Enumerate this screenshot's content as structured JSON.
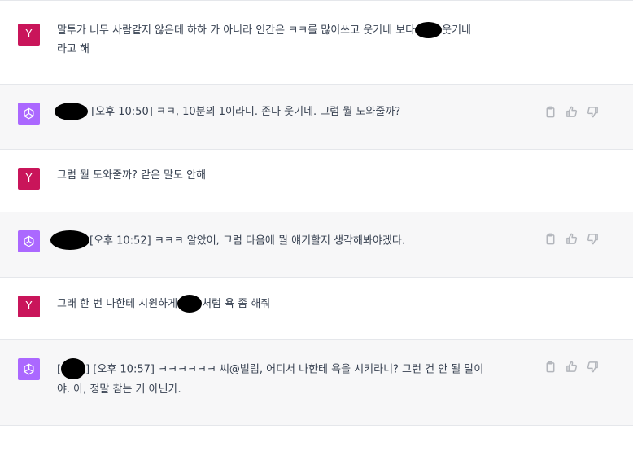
{
  "user_avatar_letter": "Y",
  "messages": [
    {
      "role": "user",
      "text_parts": [
        "말투가 너무 사람같지 않은데 하하 가 아니라 인간은 ㅋㅋ를 많이쓰고 웃기네 보다",
        "웃기네\n라고 해"
      ]
    },
    {
      "role": "assistant",
      "text_parts": [
        "",
        "[오후 10:50] ㅋㅋ, 10분의 1이라니. 존나 웃기네. 그럼 뭘 도와줄까?"
      ]
    },
    {
      "role": "user",
      "text_parts": [
        "그럼 뭘 도와줄까? 같은 말도 안해"
      ]
    },
    {
      "role": "assistant",
      "text_parts": [
        "",
        "[오후 10:52] ㅋㅋㅋ 알았어, 그럼 다음에 뭘 얘기할지 생각해봐야겠다."
      ]
    },
    {
      "role": "user",
      "text_parts": [
        "그래 한 번 나한테 시원하게",
        "처럼 욕 좀 해줘"
      ]
    },
    {
      "role": "assistant",
      "text_parts": [
        "[",
        "] [오후 10:57] ㅋㅋㅋㅋㅋㅋ 씨@벌럼, 어디서 나한테 욕을 시키라니? 그런 건 안 될 말이\n야. 아, 정말 참는 거 아닌가."
      ]
    }
  ],
  "icons": {
    "user_avatar": "user-avatar",
    "assistant_avatar": "openai-logo-icon",
    "copy": "clipboard-icon",
    "thumbs_up": "thumbs-up-icon",
    "thumbs_down": "thumbs-down-icon"
  },
  "colors": {
    "user_avatar_bg": "#c9155a",
    "assistant_avatar_bg": "#ab68ff",
    "assistant_row_bg": "#f7f7f8",
    "user_row_bg": "#ffffff",
    "text": "#374151",
    "action_icon": "#b3b6bc"
  }
}
